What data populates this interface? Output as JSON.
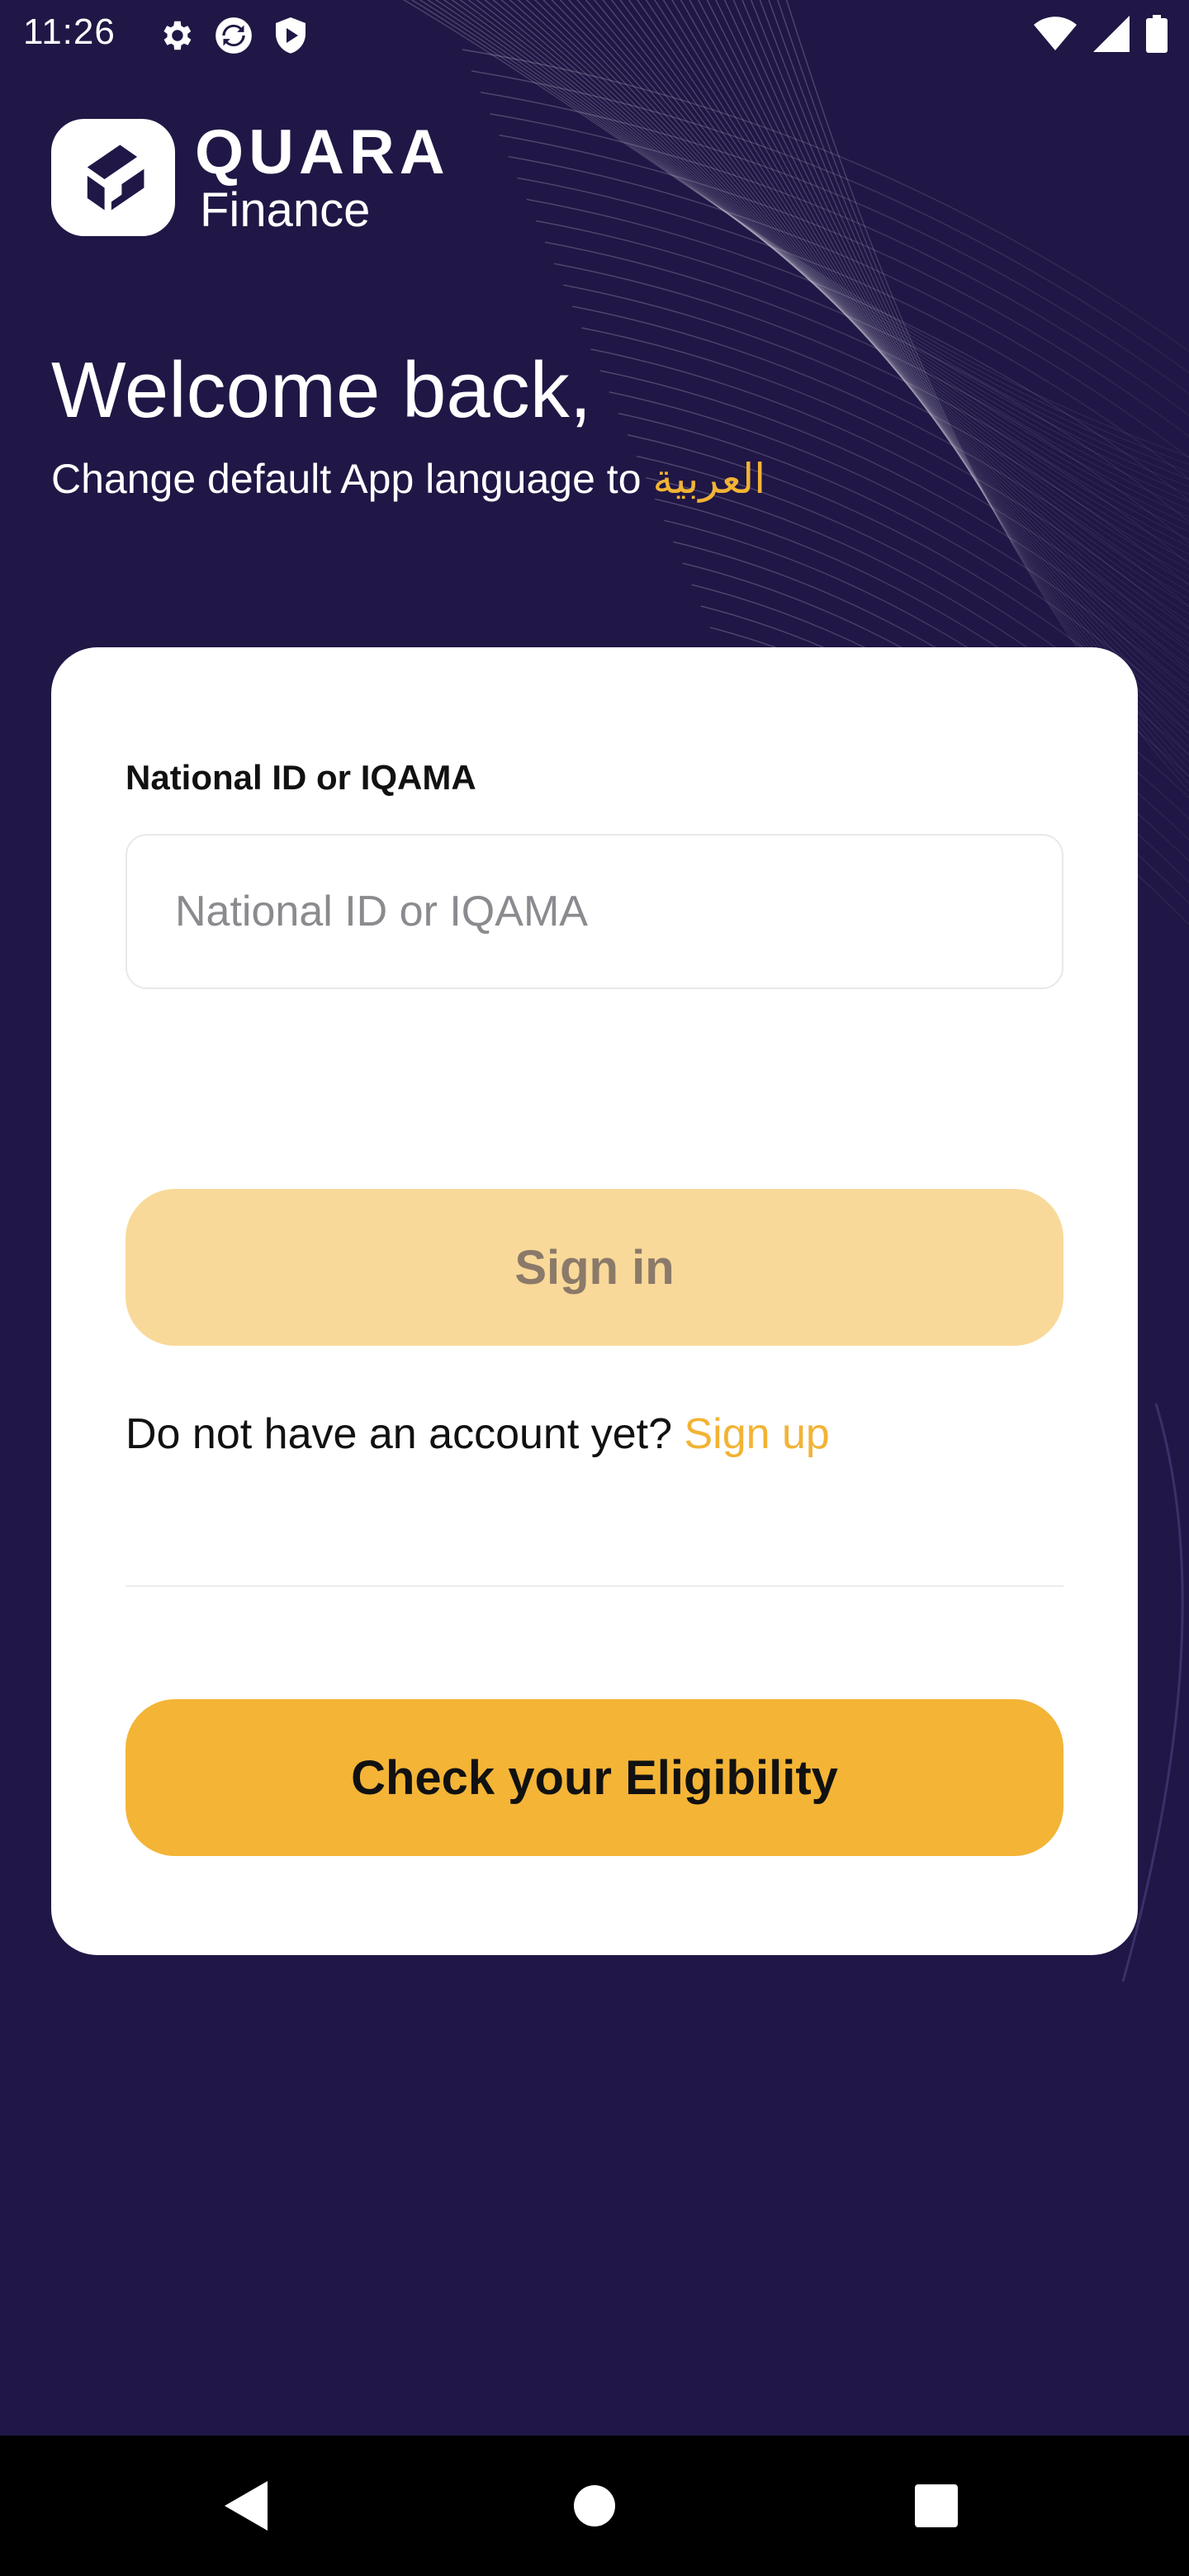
{
  "status_bar": {
    "time": "11:26",
    "left_icons": [
      "settings-gear-icon",
      "sync-icon",
      "shield-icon"
    ],
    "right_icons": [
      "wifi-icon",
      "cellular-signal-icon",
      "battery-icon"
    ]
  },
  "brand": {
    "name": "QUARA",
    "subtitle": "Finance"
  },
  "greeting": {
    "title": "Welcome back,",
    "language_prompt": "Change default App language to",
    "language_option": "العربية"
  },
  "login_form": {
    "id_label": "National ID or IQAMA",
    "id_placeholder": "National ID or IQAMA",
    "id_value": "",
    "signin_label": "Sign in",
    "signup_prompt": "Do not have an account yet?",
    "signup_link": "Sign up",
    "eligibility_label": "Check your Eligibility"
  },
  "nav_bar": {
    "buttons": [
      "back-icon",
      "home-icon",
      "recents-icon"
    ]
  },
  "colors": {
    "background": "#201746",
    "accent": "#f4b436",
    "accent_disabled": "#f9d999",
    "card": "#ffffff",
    "link": "#f2b335"
  }
}
